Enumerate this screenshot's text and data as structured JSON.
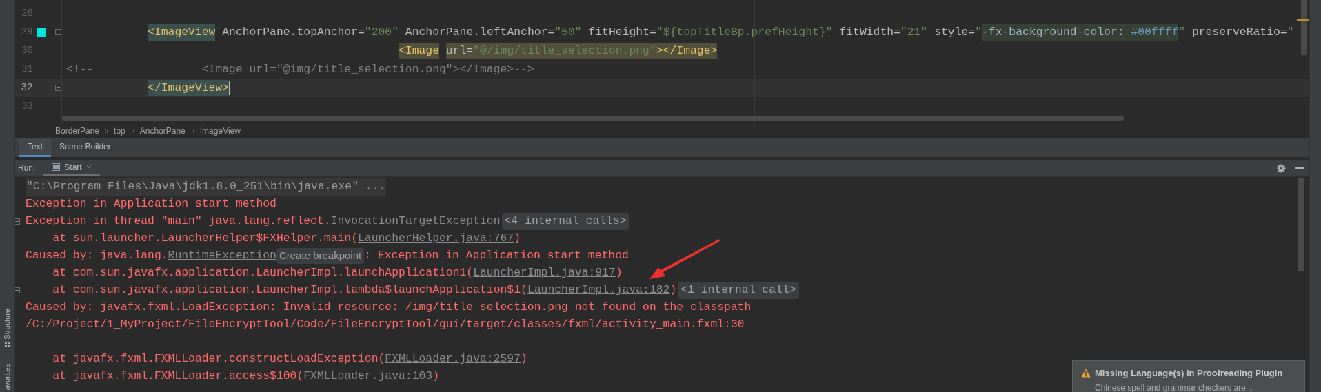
{
  "editor": {
    "lines": [
      {
        "number": "28",
        "current": false,
        "bookmark": false,
        "fold": false
      },
      {
        "number": "29",
        "current": false,
        "bookmark": true,
        "fold": true,
        "tokens": [
          {
            "kind": "tag",
            "text": "            <ImageView",
            "color": "#3b514d"
          },
          {
            "kind": "attr",
            "text": " AnchorPane.topAnchor="
          },
          {
            "kind": "value",
            "text": "\"200\""
          },
          {
            "kind": "attr",
            "text": " AnchorPane.leftAnchor="
          },
          {
            "kind": "value",
            "text": "\"50\""
          },
          {
            "kind": "attr",
            "text": " fitHeight="
          },
          {
            "kind": "value",
            "text": "\"${topTitleBp.prefHeight}\""
          },
          {
            "kind": "attr",
            "text": " fitWidth="
          },
          {
            "kind": "value",
            "text": "\"21\""
          },
          {
            "kind": "attr",
            "text": " style="
          },
          {
            "kind": "value",
            "text": "\""
          },
          {
            "kind": "style",
            "text": "-fx-background-color: ",
            "color": "#344134"
          },
          {
            "kind": "number",
            "text": "#00ffff",
            "color": "#344134"
          },
          {
            "kind": "value",
            "text": "\""
          },
          {
            "kind": "attr",
            "text": " preserveRatio="
          },
          {
            "kind": "value",
            "text": "\""
          }
        ]
      },
      {
        "number": "30",
        "current": false,
        "bookmark": false,
        "fold": false,
        "tokens": [
          {
            "kind": "tag",
            "text": "                                                 <Image",
            "color": "#52503a"
          },
          {
            "kind": "attr",
            "text": " url=",
            "color": "#52503a"
          },
          {
            "kind": "value",
            "text": "\"@/img/title_selection.png\"",
            "color": "#52503a"
          },
          {
            "kind": "tag",
            "text": "></Image>",
            "color": "#52503a"
          }
        ]
      },
      {
        "number": "31",
        "current": false,
        "bookmark": false,
        "fold": false,
        "tokens": [
          {
            "kind": "comment",
            "text": "<!--                <Image url=\"@img/title_selection.png\"></Image>-->"
          }
        ]
      },
      {
        "number": "32",
        "current": true,
        "bookmark": false,
        "fold": true,
        "tokens": [
          {
            "kind": "tag",
            "text": "            </ImageView>",
            "color": "#3b514d"
          }
        ]
      },
      {
        "number": "33",
        "current": false,
        "bookmark": false,
        "fold": false
      }
    ],
    "breadcrumbs": [
      "BorderPane",
      "top",
      "AnchorPane",
      "ImageView"
    ]
  },
  "view_tabs": [
    {
      "label": "Text",
      "selected": true
    },
    {
      "label": "Scene Builder",
      "selected": false
    }
  ],
  "run_panel": {
    "label": "Run:",
    "tab": "Start",
    "console": [
      {
        "expandable": false,
        "gap_before": false,
        "segments": [
          {
            "kind": "command",
            "text": "\"C:\\Program Files\\Java\\jdk1.8.0_251\\bin\\java.exe\" ..."
          }
        ]
      },
      {
        "expandable": false,
        "gap_before": false,
        "segments": [
          {
            "kind": "error",
            "text": "Exception in Application start method"
          }
        ]
      },
      {
        "expandable": true,
        "gap_before": false,
        "segments": [
          {
            "kind": "error",
            "text": "Exception in thread \"main\" java.lang.reflect."
          },
          {
            "kind": "link",
            "text": "InvocationTargetException"
          },
          {
            "kind": "fold",
            "text": "<4 internal calls>"
          }
        ]
      },
      {
        "expandable": false,
        "gap_before": false,
        "segments": [
          {
            "kind": "error",
            "text": "    at sun.launcher.LauncherHelper$FXHelper.main("
          },
          {
            "kind": "link",
            "text": "LauncherHelper.java:767"
          },
          {
            "kind": "error",
            "text": ")"
          }
        ]
      },
      {
        "expandable": false,
        "gap_before": false,
        "segments": [
          {
            "kind": "error",
            "text": "Caused by: java.lang."
          },
          {
            "kind": "link",
            "text": "RuntimeException"
          },
          {
            "kind": "hint",
            "text": "Create breakpoint"
          },
          {
            "kind": "error",
            "text": ": Exception in Application start method"
          }
        ]
      },
      {
        "expandable": false,
        "gap_before": false,
        "segments": [
          {
            "kind": "error",
            "text": "    at com.sun.javafx.application.LauncherImpl.launchApplication1("
          },
          {
            "kind": "link",
            "text": "LauncherImpl.java:917"
          },
          {
            "kind": "error",
            "text": ")"
          }
        ]
      },
      {
        "expandable": true,
        "gap_before": false,
        "segments": [
          {
            "kind": "error",
            "text": "    at com.sun.javafx.application.LauncherImpl.lambda$launchApplication$1("
          },
          {
            "kind": "link",
            "text": "LauncherImpl.java:182"
          },
          {
            "kind": "error",
            "text": ")"
          },
          {
            "kind": "fold",
            "text": "<1 internal call>"
          }
        ]
      },
      {
        "expandable": false,
        "gap_before": false,
        "segments": [
          {
            "kind": "error",
            "text": "Caused by: javafx.fxml.LoadException: Invalid resource: /img/title_selection.png not found on the classpath"
          }
        ]
      },
      {
        "expandable": false,
        "gap_before": false,
        "segments": [
          {
            "kind": "error",
            "text": "/C:/Project/1_MyProject/FileEncryptTool/Code/FileEncryptTool/gui/target/classes/fxml/activity_main.fxml:30"
          }
        ]
      },
      {
        "expandable": false,
        "gap_before": true,
        "segments": [
          {
            "kind": "error",
            "text": "    at javafx.fxml.FXMLLoader.constructLoadException("
          },
          {
            "kind": "link",
            "text": "FXMLLoader.java:2597"
          },
          {
            "kind": "error",
            "text": ")"
          }
        ]
      },
      {
        "expandable": false,
        "gap_before": false,
        "segments": [
          {
            "kind": "error",
            "text": "    at javafx.fxml.FXMLLoader.access$100("
          },
          {
            "kind": "link",
            "text": "FXMLLoader.java:103"
          },
          {
            "kind": "error",
            "text": ")"
          }
        ]
      }
    ]
  },
  "left_strip": [
    "Structure",
    "avorites"
  ],
  "notification": {
    "title": "Missing Language(s) in Proofreading Plugin",
    "body": "Chinese spell and grammar checkers are..."
  }
}
